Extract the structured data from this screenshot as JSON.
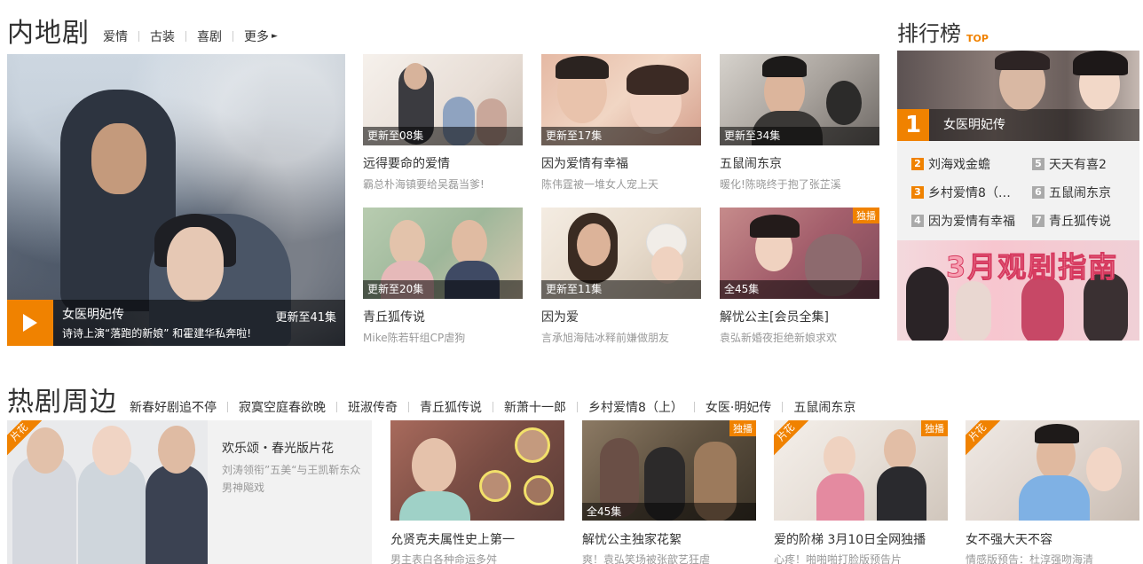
{
  "mainland": {
    "title": "内地剧",
    "tags": [
      "爱情",
      "古装",
      "喜剧",
      "更多"
    ],
    "hero": {
      "title": "女医明妃传",
      "desc": "诗诗上演“落跑的新娘” 和霍建华私奔啦!",
      "update": "更新至41集"
    },
    "cards": [
      {
        "caption": "更新至08集",
        "title": "远得要命的爱情",
        "sub": "霸总朴海镇要给吴磊当爹!"
      },
      {
        "caption": "更新至17集",
        "title": "因为爱情有幸福",
        "sub": "陈伟霆被一堆女人宠上天"
      },
      {
        "caption": "更新至34集",
        "title": "五鼠闹东京",
        "sub": "暖化!陈晓终于抱了张芷溪"
      },
      {
        "caption": "更新至20集",
        "title": "青丘狐传说",
        "sub": "Mike陈若轩组CP虐狗"
      },
      {
        "caption": "更新至11集",
        "title": "因为爱",
        "sub": "言承旭海陆冰释前嫌做朋友"
      },
      {
        "caption": "全45集",
        "title": "解忧公主[会员全集]",
        "sub": "袁弘新婚夜拒绝新娘求欢",
        "badge": "独播"
      }
    ]
  },
  "ranking": {
    "title": "排行榜",
    "top_label": "TOP",
    "first": {
      "num": "1",
      "name": "女医明妃传"
    },
    "items": [
      {
        "num": "2",
        "name": "刘海戏金蟾"
      },
      {
        "num": "5",
        "name": "天天有喜2"
      },
      {
        "num": "3",
        "name": "乡村爱情8（…"
      },
      {
        "num": "6",
        "name": "五鼠闹东京"
      },
      {
        "num": "4",
        "name": "因为爱情有幸福"
      },
      {
        "num": "7",
        "name": "青丘狐传说"
      }
    ],
    "banner_text": "3月观剧指南"
  },
  "hot": {
    "title": "热剧周边",
    "tags": [
      "新春好剧追不停",
      "寂寞空庭春欲晚",
      "班淑传奇",
      "青丘狐传说",
      "新萧十一郎",
      "乡村爱情8（上）",
      "女医·明妃传",
      "五鼠闹东京"
    ],
    "featured": {
      "corner": "片花",
      "title": "欢乐颂・春光版片花",
      "desc": "刘涛领衔”五美“与王凯靳东众男神飚戏"
    },
    "cards": [
      {
        "title": "允贤克夫属性史上第一",
        "sub": "男主表白各种命运多舛"
      },
      {
        "title": "解忧公主独家花絮",
        "sub": "爽！袁弘笑场被张歆艺狂虐",
        "caption": "全45集",
        "badge": "独播"
      },
      {
        "title": "爱的阶梯 3月10日全网独播",
        "sub": "心疼！啪啪啪打脸版预告片",
        "badge": "独播",
        "corner": "片花"
      },
      {
        "title": "女不强大天不容",
        "sub": "情感版预告：杜淳强吻海清",
        "corner": "片花"
      }
    ]
  },
  "colors": {
    "accent": "#f08200",
    "muted": "#999999"
  }
}
